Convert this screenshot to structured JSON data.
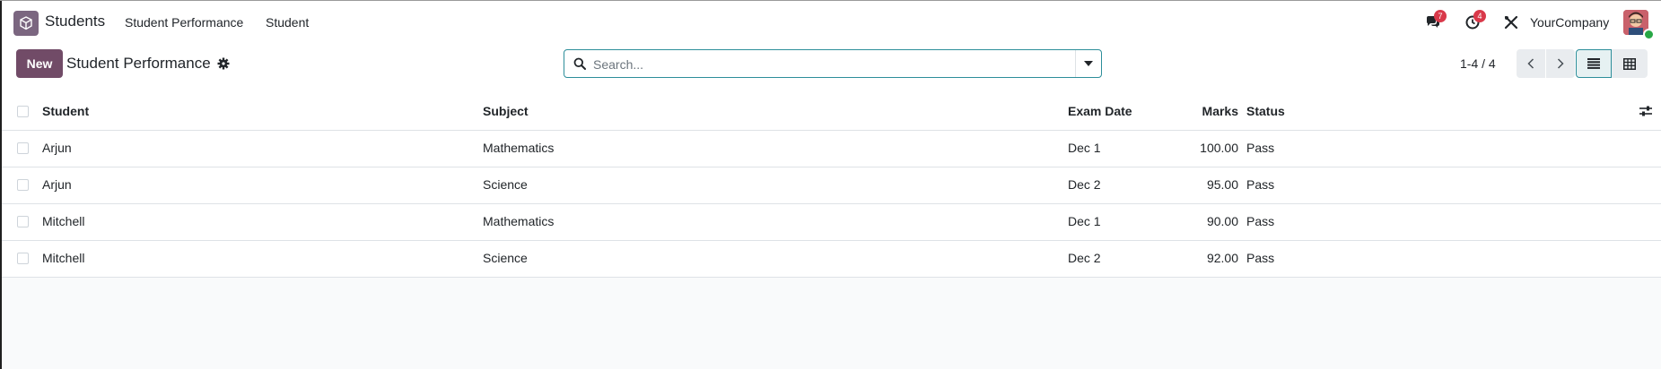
{
  "navbar": {
    "app_name": "Students",
    "menu": [
      "Student Performance",
      "Student"
    ],
    "messages_count": "7",
    "activities_count": "4",
    "company": "YourCompany"
  },
  "control": {
    "new_label": "New",
    "title": "Student Performance",
    "search_placeholder": "Search...",
    "pager": "1-4 / 4"
  },
  "table": {
    "columns": [
      "Student",
      "Subject",
      "Exam Date",
      "Marks",
      "Status"
    ],
    "rows": [
      {
        "student": "Arjun",
        "subject": "Mathematics",
        "date": "Dec 1",
        "marks": "100.00",
        "status": "Pass"
      },
      {
        "student": "Arjun",
        "subject": "Science",
        "date": "Dec 2",
        "marks": "95.00",
        "status": "Pass"
      },
      {
        "student": "Mitchell",
        "subject": "Mathematics",
        "date": "Dec 1",
        "marks": "90.00",
        "status": "Pass"
      },
      {
        "student": "Mitchell",
        "subject": "Science",
        "date": "Dec 2",
        "marks": "92.00",
        "status": "Pass"
      }
    ]
  },
  "colors": {
    "primary": "#714b67",
    "search_border": "#2d8e9a",
    "badge": "#d9394a",
    "online": "#28a745"
  }
}
